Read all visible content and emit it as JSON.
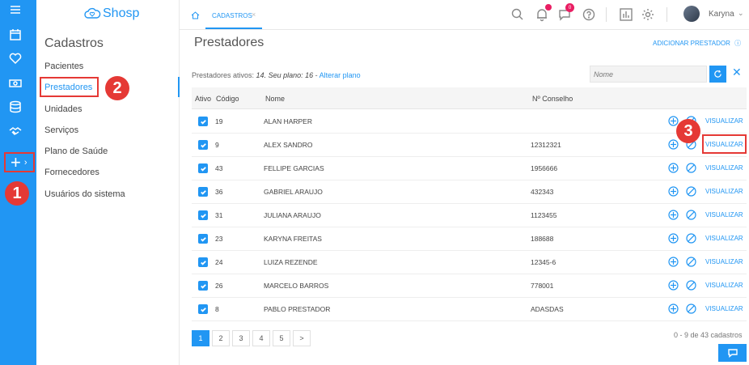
{
  "app": {
    "logo_text": "Shosp"
  },
  "sidebar": {
    "icons": [
      "menu-icon",
      "calendar-icon",
      "heart-icon",
      "money-icon",
      "database-icon",
      "handshake-icon"
    ],
    "plus_label": "+",
    "plus_chevron": "›"
  },
  "submenu": {
    "title": "Cadastros",
    "items": [
      {
        "label": "Pacientes"
      },
      {
        "label": "Prestadores"
      },
      {
        "label": "Unidades"
      },
      {
        "label": "Serviços"
      },
      {
        "label": "Plano de Saúde"
      },
      {
        "label": "Fornecedores"
      },
      {
        "label": "Usuários do sistema"
      }
    ]
  },
  "markers": {
    "m1": "1",
    "m2": "2",
    "m3": "3"
  },
  "topbar": {
    "tab_label": "CADASTROS",
    "tab_close": "×",
    "notif_badge": "",
    "chat_badge": "0",
    "user_name": "Karyna",
    "user_chevron": "⌄"
  },
  "main": {
    "title": "Prestadores",
    "add_button": "ADICIONAR PRESTADOR",
    "info_prefix": "Prestadores ativos: ",
    "info_active": "14",
    "info_mid": ". Seu plano: ",
    "info_plan": "16",
    "info_sep": " - ",
    "info_link": "Alterar plano",
    "search_placeholder": "Nome",
    "clear_symbol": "✕"
  },
  "table": {
    "headers": {
      "ativo": "Ativo",
      "codigo": "Código",
      "nome": "Nome",
      "conselho": "Nº Conselho"
    },
    "action_label": "VISUALIZAR",
    "rows": [
      {
        "ativo": true,
        "codigo": "19",
        "nome": "ALAN HARPER",
        "conselho": ""
      },
      {
        "ativo": true,
        "codigo": "9",
        "nome": "ALEX SANDRO",
        "conselho": "12312321"
      },
      {
        "ativo": true,
        "codigo": "43",
        "nome": "FELLIPE GARCIAS",
        "conselho": "1956666"
      },
      {
        "ativo": true,
        "codigo": "36",
        "nome": "GABRIEL ARAUJO",
        "conselho": "432343"
      },
      {
        "ativo": true,
        "codigo": "31",
        "nome": "JULIANA ARAUJO",
        "conselho": "1123455"
      },
      {
        "ativo": true,
        "codigo": "23",
        "nome": "KARYNA FREITAS",
        "conselho": "188688"
      },
      {
        "ativo": true,
        "codigo": "24",
        "nome": "LUIZA REZENDE",
        "conselho": "12345-6"
      },
      {
        "ativo": true,
        "codigo": "26",
        "nome": "MARCELO BARROS",
        "conselho": "778001"
      },
      {
        "ativo": true,
        "codigo": "8",
        "nome": "PABLO PRESTADOR",
        "conselho": "ADASDAS"
      }
    ]
  },
  "pagination": {
    "pages": [
      "1",
      "2",
      "3",
      "4",
      "5",
      ">"
    ],
    "current": "1",
    "count_text": "0 - 9 de 43 cadastros"
  },
  "colors": {
    "accent": "#2196f3",
    "highlight": "#e53935",
    "badge": "#e91e63"
  }
}
